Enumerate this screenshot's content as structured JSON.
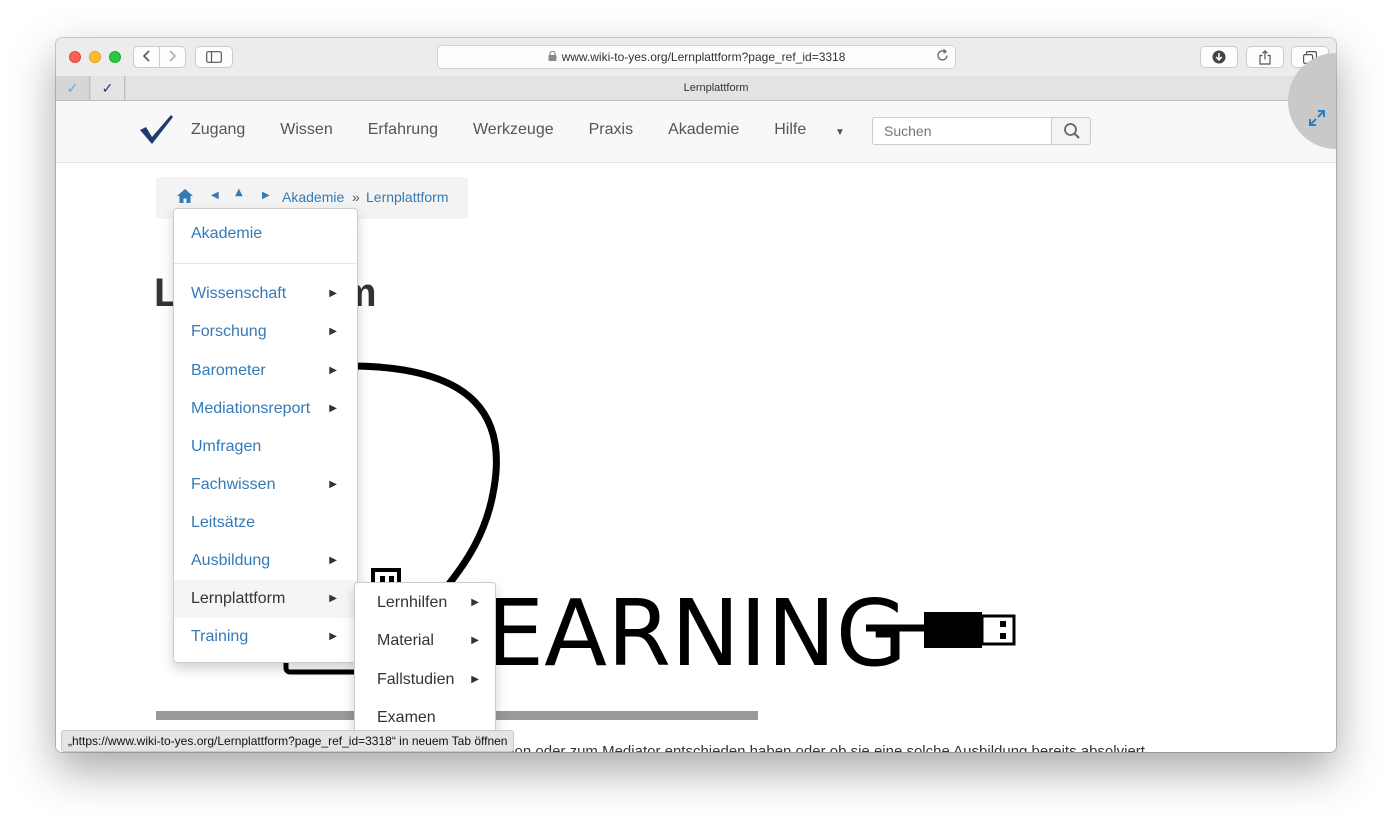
{
  "browser": {
    "url": "www.wiki-to-yes.org/Lernplattform?page_ref_id=3318",
    "tab_title": "Lernplattform",
    "status_link": "„https://www.wiki-to-yes.org/Lernplattform?page_ref_id=3318“ in neuem Tab öffnen"
  },
  "site": {
    "nav": [
      "Zugang",
      "Wissen",
      "Erfahrung",
      "Werkzeuge",
      "Praxis",
      "Akademie",
      "Hilfe"
    ],
    "search_placeholder": "Suchen"
  },
  "breadcrumb": {
    "items": [
      "Akademie",
      "Lernplattform"
    ],
    "separator": "»"
  },
  "page": {
    "title_visible_start": "L",
    "title_visible_end": "rm",
    "image_word": "EARNING",
    "body_text": "Ganz gleich, ob sie sich für eine Ausbildung in Mediation oder zum Mediator entschieden haben oder ob sie eine solche Ausbildung bereits absolviert"
  },
  "dropdown": {
    "header": "Akademie",
    "items": [
      {
        "label": "Wissenschaft",
        "has_submenu": true
      },
      {
        "label": "Forschung",
        "has_submenu": true
      },
      {
        "label": "Barometer",
        "has_submenu": true
      },
      {
        "label": "Mediationsreport",
        "has_submenu": true
      },
      {
        "label": "Umfragen",
        "has_submenu": false
      },
      {
        "label": "Fachwissen",
        "has_submenu": true
      },
      {
        "label": "Leitsätze",
        "has_submenu": false
      },
      {
        "label": "Ausbildung",
        "has_submenu": true
      },
      {
        "label": "Lernplattform",
        "has_submenu": true,
        "active": true
      },
      {
        "label": "Training",
        "has_submenu": true
      }
    ]
  },
  "submenu": {
    "items": [
      {
        "label": "Lernhilfen",
        "has_submenu": true
      },
      {
        "label": "Material",
        "has_submenu": true
      },
      {
        "label": "Fallstudien",
        "has_submenu": true
      },
      {
        "label": "Examen",
        "has_submenu": false
      }
    ]
  },
  "colors": {
    "link": "#337ab7",
    "logo": "#1f3a6e",
    "text": "#333333"
  },
  "icons": [
    "back-icon",
    "forward-icon",
    "sidebar-icon",
    "lock-icon",
    "reload-icon",
    "download-icon",
    "share-icon",
    "tabs-icon",
    "checkmark-icon",
    "search-icon",
    "expand-icon",
    "home-icon",
    "caret-left-icon",
    "caret-up-icon",
    "caret-right-icon",
    "caret-down-icon"
  ]
}
